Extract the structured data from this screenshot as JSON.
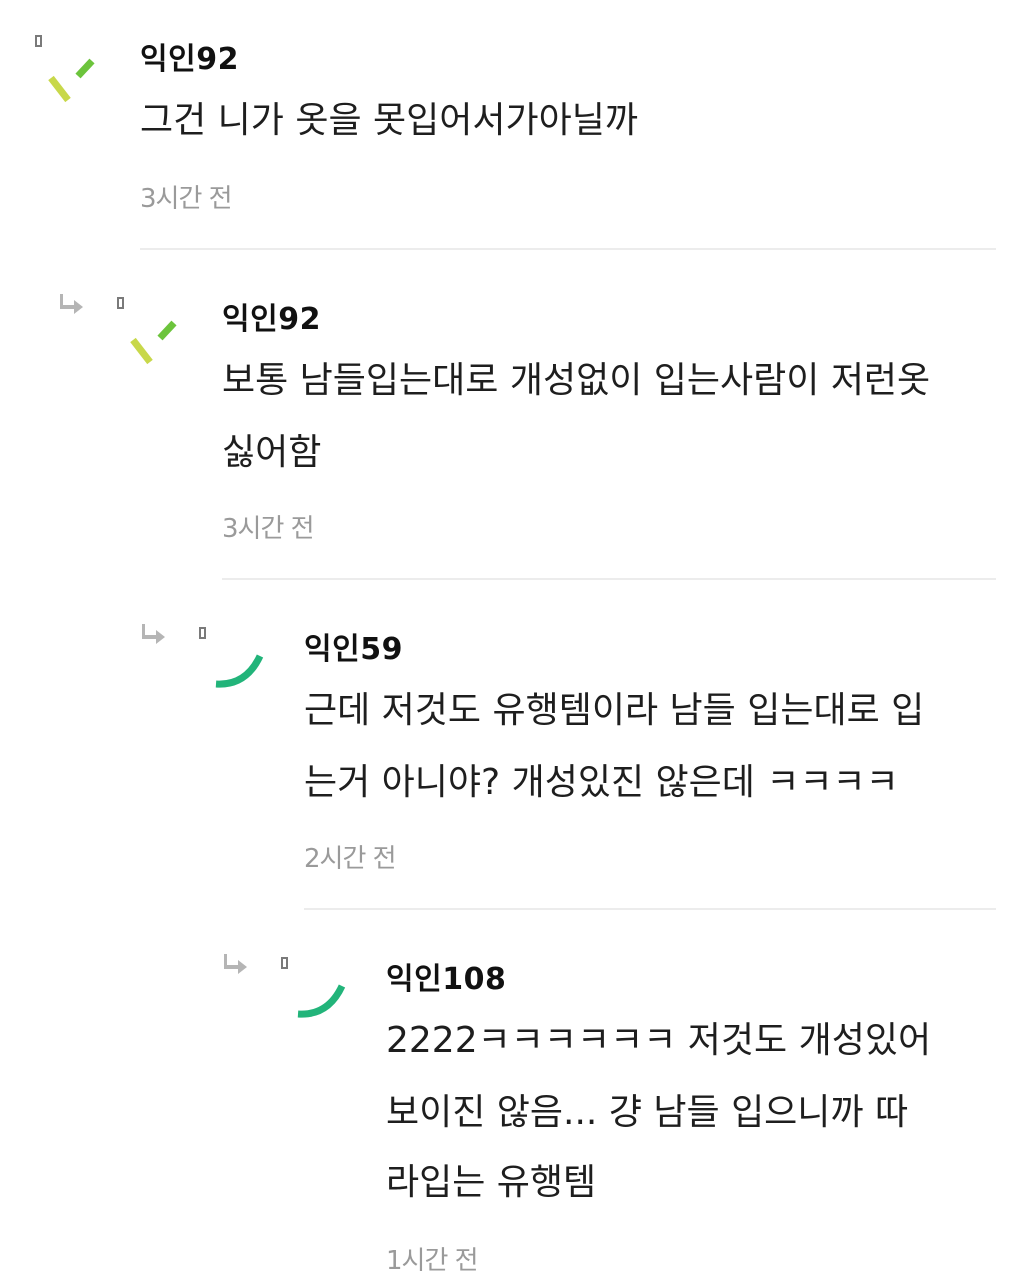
{
  "comments": [
    {
      "nickname": "익인92",
      "lines": [
        "그건 니가 옷을 못입어서가아닐까"
      ],
      "time": "3시간 전",
      "avatar": "check-mark-icon",
      "reply": false
    },
    {
      "nickname": "익인92",
      "lines": [
        "보통 남들입는대로 개성없이 입는사람이 저런옷",
        "싫어함"
      ],
      "time": "3시간 전",
      "avatar": "check-mark-icon",
      "reply": true
    },
    {
      "nickname": "익인59",
      "lines": [
        "근데 저것도 유행템이라 남들 입는대로 입",
        "는거 아니야? 개성있진 않은데 ㅋㅋㅋㅋ"
      ],
      "time": "2시간 전",
      "avatar": "smile-arc-icon",
      "reply": true
    },
    {
      "nickname": "익인108",
      "lines": [
        "2222ㅋㅋㅋㅋㅋㅋ 저것도 개성있어",
        "보이진 않음... 걍 남들 입으니까 따",
        "라입는 유행템"
      ],
      "time": "1시간 전",
      "avatar": "smile-arc-icon",
      "reply": true
    }
  ],
  "colors": {
    "check_light": "#c8d84a",
    "check_dark": "#6cc43c",
    "smile": "#22b47a",
    "arrow": "#b5b5b5",
    "time": "#9a9a9a",
    "divider": "#ececec"
  }
}
